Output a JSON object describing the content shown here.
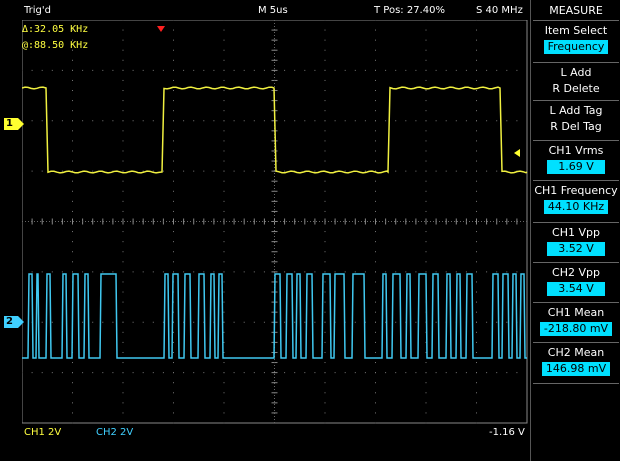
{
  "status": {
    "trigger_state": "Trig'd",
    "timebase": "M 5us",
    "trigger_position": "T Pos: 27.40%",
    "sample_rate": "S 40 MHz"
  },
  "cursors": {
    "cursor_a": "Δ:32.05 KHz",
    "cursor_b": "@:88.50 KHz"
  },
  "channels": [
    {
      "marker": "1",
      "color": "#ffff30",
      "scale_label": "CH1  2V"
    },
    {
      "marker": "2",
      "color": "#40d0ff",
      "scale_label": "CH2  2V"
    }
  ],
  "trigger_level": "-1.16 V",
  "menu": {
    "title": "MEASURE",
    "item_select_label": "Item Select",
    "item_select_value": "Frequency",
    "add_label": "L Add",
    "delete_label": "R Delete",
    "add_tag_label": "L Add Tag",
    "del_tag_label": "R Del Tag",
    "measurements": [
      {
        "label": "CH1 Vrms",
        "value": "1.69 V"
      },
      {
        "label": "CH1 Frequency",
        "value": "44.10 KHz"
      },
      {
        "label": "CH1 Vpp",
        "value": "3.52 V"
      },
      {
        "label": "CH2 Vpp",
        "value": "3.54 V"
      },
      {
        "label": "CH1 Mean",
        "value": "-218.80 mV"
      },
      {
        "label": "CH2 Mean",
        "value": "146.98 mV"
      }
    ]
  }
}
